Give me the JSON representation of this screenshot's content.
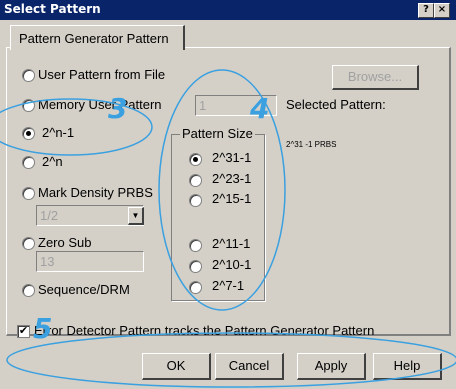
{
  "window": {
    "title": "Select Pattern",
    "help_glyph": "?",
    "close_glyph": "×"
  },
  "tab": {
    "label": "Pattern Generator Pattern"
  },
  "radios": [
    {
      "label": "User Pattern from File",
      "checked": false
    },
    {
      "label": "Memory User Pattern",
      "checked": false
    },
    {
      "label": "2^n-1",
      "checked": true
    },
    {
      "label": "2^n",
      "checked": false
    },
    {
      "label": "Mark Density PRBS",
      "checked": false
    },
    {
      "label": "Zero Sub",
      "checked": false
    },
    {
      "label": "Sequence/DRM",
      "checked": false
    }
  ],
  "browse_button": {
    "label": "Browse..."
  },
  "memory_field": {
    "value": "1"
  },
  "selected_pattern": {
    "label": "Selected Pattern:",
    "value": "2^31 -1 PRBS"
  },
  "mark_density_select": {
    "value": "1/2"
  },
  "zero_sub_field": {
    "value": "13"
  },
  "pattern_size": {
    "title": "Pattern Size",
    "options": [
      {
        "label": "2^31-1",
        "checked": true
      },
      {
        "label": "2^23-1",
        "checked": false
      },
      {
        "label": "2^15-1",
        "checked": false
      },
      {
        "label": "2^11-1",
        "checked": false
      },
      {
        "label": "2^10-1",
        "checked": false
      },
      {
        "label": "2^7-1",
        "checked": false
      }
    ]
  },
  "error_detector_checkbox": {
    "label": "Error Detector Pattern tracks the Pattern Generator Pattern",
    "checked": true
  },
  "buttons": {
    "ok": "OK",
    "cancel": "Cancel",
    "apply": "Apply",
    "help": "Help"
  },
  "annotations": {
    "three": "3",
    "four": "4",
    "five": "5",
    "color": "#3aa0e0"
  }
}
